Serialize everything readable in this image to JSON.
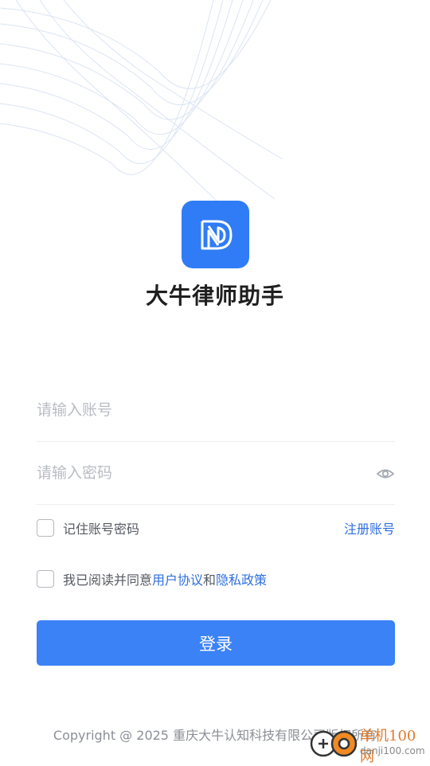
{
  "app": {
    "title": "大牛律师助手"
  },
  "form": {
    "account_placeholder": "请输入账号",
    "password_placeholder": "请输入密码",
    "remember_label": "记住账号密码",
    "register_link": "注册账号",
    "agreement_prefix": "我已阅读并同意",
    "user_agreement_link": "用户协议",
    "agreement_and": "和",
    "privacy_policy_link": "隐私政策",
    "login_button": "登录"
  },
  "footer": {
    "copyright": "Copyright @ 2025 重庆大牛认知科技有限公司版权所有"
  },
  "watermark": {
    "cn": "单机100网",
    "en": "danji100.com"
  },
  "colors": {
    "brand": "#2f7cf6",
    "button": "#3b82f6",
    "link": "#2f6fe0"
  }
}
